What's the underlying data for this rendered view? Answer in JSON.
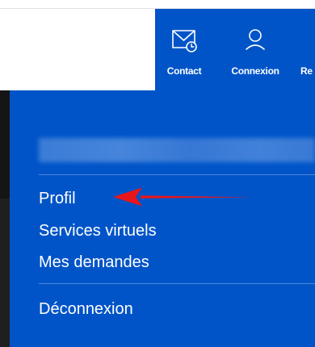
{
  "header": {
    "nav": {
      "contact": {
        "label": "Contact",
        "icon": "envelope-clock-icon"
      },
      "connexion": {
        "label": "Connexion",
        "icon": "user-icon"
      },
      "cut_label": "Re"
    }
  },
  "dropdown": {
    "items": [
      {
        "label": "Profil"
      },
      {
        "label": "Services virtuels"
      },
      {
        "label": "Mes demandes"
      },
      {
        "label": "Déconnexion"
      }
    ]
  },
  "colors": {
    "brand_blue": "#0054c8",
    "divider_blue": "#4d86d6",
    "annotation_red": "#e8161a",
    "dark_strip": "#151515"
  }
}
